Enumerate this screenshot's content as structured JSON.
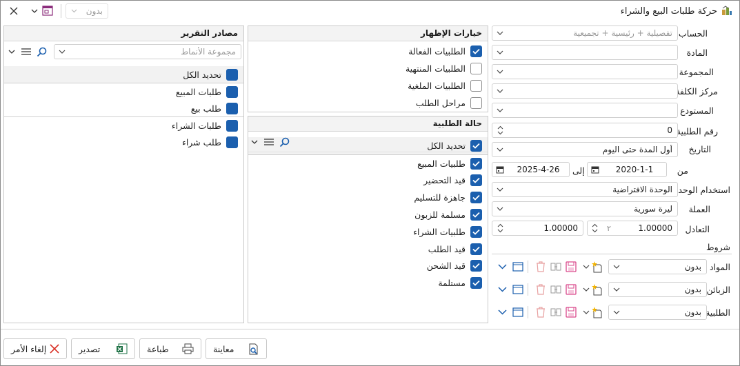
{
  "window": {
    "title": "حركة طلبات البيع والشراء",
    "close_label": "✕",
    "top_combo": "بدون"
  },
  "fields": {
    "account": {
      "label": "الحساب",
      "placeholder": "تفصيلية + رئيسية + تجميعية"
    },
    "material": {
      "label": "المادة",
      "value": ""
    },
    "group": {
      "label": "المجموعة",
      "value": ""
    },
    "cost_center": {
      "label": "مركز الكلفة",
      "value": ""
    },
    "warehouse": {
      "label": "المستودع",
      "value": ""
    },
    "order_number": {
      "label": "رقم الطلبية",
      "value": "0"
    },
    "date": {
      "label": "التاريخ",
      "value": "أول المدة حتى اليوم"
    },
    "from_label": "من",
    "from_date": "2020-1-1",
    "to_label": "إلى",
    "to_date": "2025-4-26",
    "unit_usage": {
      "label": "استخدام الوحدة",
      "value": "الوحدة الافتراضية"
    },
    "currency": {
      "label": "العملة",
      "value": "ليرة سورية"
    },
    "rate": {
      "label": "التعادل",
      "value1": "1.00000",
      "value2": "1.00000"
    }
  },
  "conditions": {
    "title": "شروط",
    "rows": [
      {
        "label": "المواد",
        "value": "بدون"
      },
      {
        "label": "الزبائن",
        "value": "بدون"
      },
      {
        "label": "الطلبية",
        "value": "بدون"
      }
    ]
  },
  "display_options": {
    "title": "خيارات الإظهار",
    "items": [
      {
        "label": "الطلبيات الفعالة",
        "checked": true
      },
      {
        "label": "الطلبيات المنتهية",
        "checked": false
      },
      {
        "label": "الطلبيات الملغية",
        "checked": false
      },
      {
        "label": "مراحل الطلب",
        "checked": false
      }
    ]
  },
  "order_status": {
    "title": "حالة الطلبية",
    "select_all": "تحديد الكل",
    "sale_group": "طلبيات المبيع",
    "sale_items": [
      "قيد التحضير",
      "جاهزة للتسليم",
      "مسلمة للزبون"
    ],
    "purchase_group": "طلبيات الشراء",
    "purchase_items": [
      "قيد الطلب",
      "قيد الشحن",
      "مستلمة"
    ]
  },
  "report_sources": {
    "title": "مصادر التقرير",
    "pattern_placeholder": "مجموعة الأنماط",
    "select_all": "تحديد الكل",
    "sale_group": "طلبات المبيع",
    "sale_item": "طلب بيع",
    "purchase_group": "طلبات الشراء",
    "purchase_item": "طلب شراء"
  },
  "footer": {
    "preview": "معاينة",
    "print": "طباعة",
    "export": "تصدير",
    "cancel": "إلغاء الأمر"
  },
  "colors": {
    "accent": "#1b5fae",
    "pink_icon": "#d9488b",
    "cancel_red": "#d93025"
  }
}
